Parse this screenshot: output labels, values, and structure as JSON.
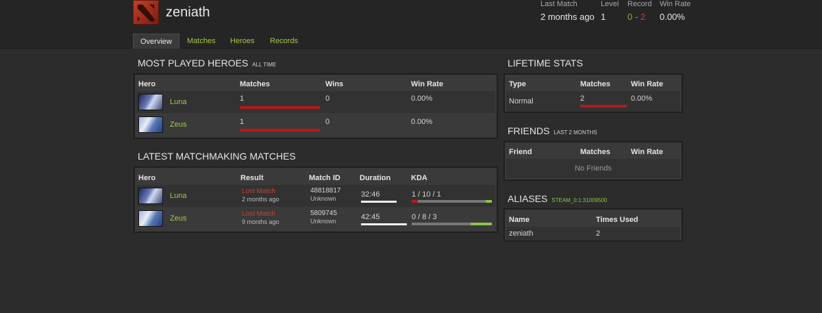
{
  "header": {
    "player_name": "zeniath",
    "stats": {
      "last_match": {
        "label": "Last Match",
        "value": "2 months ago"
      },
      "level": {
        "label": "Level",
        "value": "1"
      },
      "record": {
        "label": "Record",
        "wins": "0",
        "separator": "-",
        "losses": "2"
      },
      "win_rate": {
        "label": "Win Rate",
        "value": "0.00%"
      }
    }
  },
  "tabs": [
    {
      "label": "Overview",
      "active": true
    },
    {
      "label": "Matches"
    },
    {
      "label": "Heroes"
    },
    {
      "label": "Records"
    }
  ],
  "most_played": {
    "title": "MOST PLAYED HEROES",
    "subtitle": "ALL TIME",
    "columns": [
      "Hero",
      "Matches",
      "Wins",
      "Win Rate"
    ],
    "rows": [
      {
        "hero": "Luna",
        "matches": "1",
        "wins": "0",
        "win_rate": "0.00%",
        "matches_fraction": 1.0
      },
      {
        "hero": "Zeus",
        "matches": "1",
        "wins": "0",
        "win_rate": "0.00%",
        "matches_fraction": 1.0
      }
    ]
  },
  "latest_matches": {
    "title": "LATEST MATCHMAKING MATCHES",
    "columns": [
      "Hero",
      "Result",
      "Match ID",
      "Duration",
      "KDA"
    ],
    "rows": [
      {
        "hero": "Luna",
        "result": "Lost Match",
        "when": "2 months ago",
        "match_id": "48818817",
        "match_type": "Unknown",
        "duration": "32:46",
        "kda": "1 / 10 / 1"
      },
      {
        "hero": "Zeus",
        "result": "Lost Match",
        "when": "9 months ago",
        "match_id": "5809745",
        "match_type": "Unknown",
        "duration": "42:45",
        "kda": "0 / 8 / 3"
      }
    ]
  },
  "lifetime": {
    "title": "LIFETIME STATS",
    "columns": [
      "Type",
      "Matches",
      "Win Rate"
    ],
    "rows": [
      {
        "type": "Normal",
        "matches": "2",
        "win_rate": "0.00%"
      }
    ]
  },
  "friends": {
    "title": "FRIENDS",
    "subtitle": "LAST 2 MONTHS",
    "columns": [
      "Friend",
      "Matches",
      "Win Rate"
    ],
    "empty_text": "No Friends"
  },
  "aliases": {
    "title": "ALIASES",
    "subtitle": "STEAM_0:1:31009500",
    "columns": [
      "Name",
      "Times Used"
    ],
    "rows": [
      {
        "name": "zeniath",
        "times_used": "2"
      }
    ]
  },
  "colors": {
    "accent_green": "#a3c94a",
    "loss_red": "#c5442f",
    "bar_red": "#b41a1a"
  }
}
